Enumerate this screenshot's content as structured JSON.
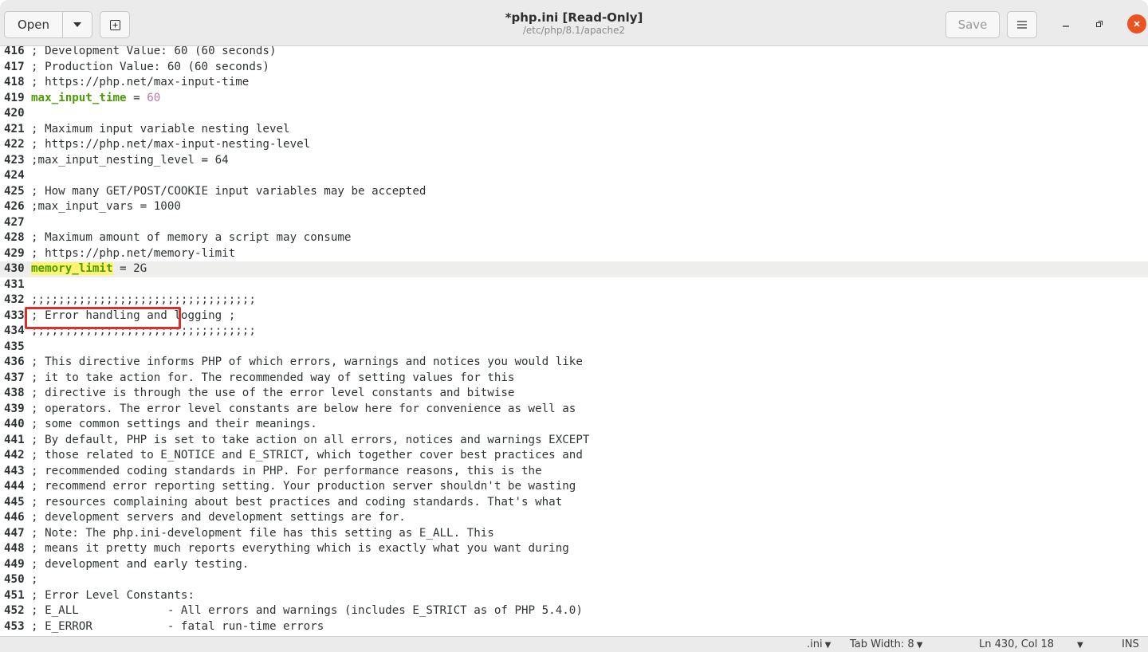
{
  "header": {
    "open_label": "Open",
    "title": "*php.ini [Read-Only]",
    "subtitle": "/etc/php/8.1/apache2",
    "save_label": "Save"
  },
  "editor": {
    "lines": [
      {
        "n": "416",
        "text": "; Development Value: 60 (60 seconds)"
      },
      {
        "n": "417",
        "text": "; Production Value: 60 (60 seconds)"
      },
      {
        "n": "418",
        "text": "; https://php.net/max-input-time"
      },
      {
        "n": "419",
        "key": "max_input_time",
        "rest": " = ",
        "value": "60"
      },
      {
        "n": "420",
        "text": ""
      },
      {
        "n": "421",
        "text": "; Maximum input variable nesting level"
      },
      {
        "n": "422",
        "text": "; https://php.net/max-input-nesting-level"
      },
      {
        "n": "423",
        "text": ";max_input_nesting_level = 64"
      },
      {
        "n": "424",
        "text": ""
      },
      {
        "n": "425",
        "text": "; How many GET/POST/COOKIE input variables may be accepted"
      },
      {
        "n": "426",
        "text": ";max_input_vars = 1000"
      },
      {
        "n": "427",
        "text": ""
      },
      {
        "n": "428",
        "text": "; Maximum amount of memory a script may consume"
      },
      {
        "n": "429",
        "text": "; https://php.net/memory-limit"
      },
      {
        "n": "430",
        "key": "memory_limit",
        "rest": " = 2G",
        "current": true
      },
      {
        "n": "431",
        "text": ""
      },
      {
        "n": "432",
        "text": ";;;;;;;;;;;;;;;;;;;;;;;;;;;;;;;;;"
      },
      {
        "n": "433",
        "text": "; Error handling and logging ;"
      },
      {
        "n": "434",
        "text": ";;;;;;;;;;;;;;;;;;;;;;;;;;;;;;;;;"
      },
      {
        "n": "435",
        "text": ""
      },
      {
        "n": "436",
        "text": "; This directive informs PHP of which errors, warnings and notices you would like"
      },
      {
        "n": "437",
        "text": "; it to take action for. The recommended way of setting values for this"
      },
      {
        "n": "438",
        "text": "; directive is through the use of the error level constants and bitwise"
      },
      {
        "n": "439",
        "text": "; operators. The error level constants are below here for convenience as well as"
      },
      {
        "n": "440",
        "text": "; some common settings and their meanings."
      },
      {
        "n": "441",
        "text": "; By default, PHP is set to take action on all errors, notices and warnings EXCEPT"
      },
      {
        "n": "442",
        "text": "; those related to E_NOTICE and E_STRICT, which together cover best practices and"
      },
      {
        "n": "443",
        "text": "; recommended coding standards in PHP. For performance reasons, this is the"
      },
      {
        "n": "444",
        "text": "; recommend error reporting setting. Your production server shouldn't be wasting"
      },
      {
        "n": "445",
        "text": "; resources complaining about best practices and coding standards. That's what"
      },
      {
        "n": "446",
        "text": "; development servers and development settings are for."
      },
      {
        "n": "447",
        "text": "; Note: The php.ini-development file has this setting as E_ALL. This"
      },
      {
        "n": "448",
        "text": "; means it pretty much reports everything which is exactly what you want during"
      },
      {
        "n": "449",
        "text": "; development and early testing."
      },
      {
        "n": "450",
        "text": ";"
      },
      {
        "n": "451",
        "text": "; Error Level Constants:"
      },
      {
        "n": "452",
        "text": "; E_ALL             - All errors and warnings (includes E_STRICT as of PHP 5.4.0)"
      },
      {
        "n": "453",
        "text": "; E_ERROR           - fatal run-time errors"
      }
    ]
  },
  "statusbar": {
    "language": ".ini",
    "tab_width": "Tab Width: 8",
    "position": "Ln 430, Col 18",
    "mode": "INS"
  },
  "colors": {
    "key": "#4e9a06",
    "number": "#ad7fa8",
    "highlight": "#fcf56f",
    "annotation": "#d9302c",
    "close": "#e95420"
  },
  "icons": [
    "chevron-down-icon",
    "new-tab-icon",
    "hamburger-menu-icon",
    "minimize-icon",
    "maximize-icon",
    "close-icon"
  ]
}
